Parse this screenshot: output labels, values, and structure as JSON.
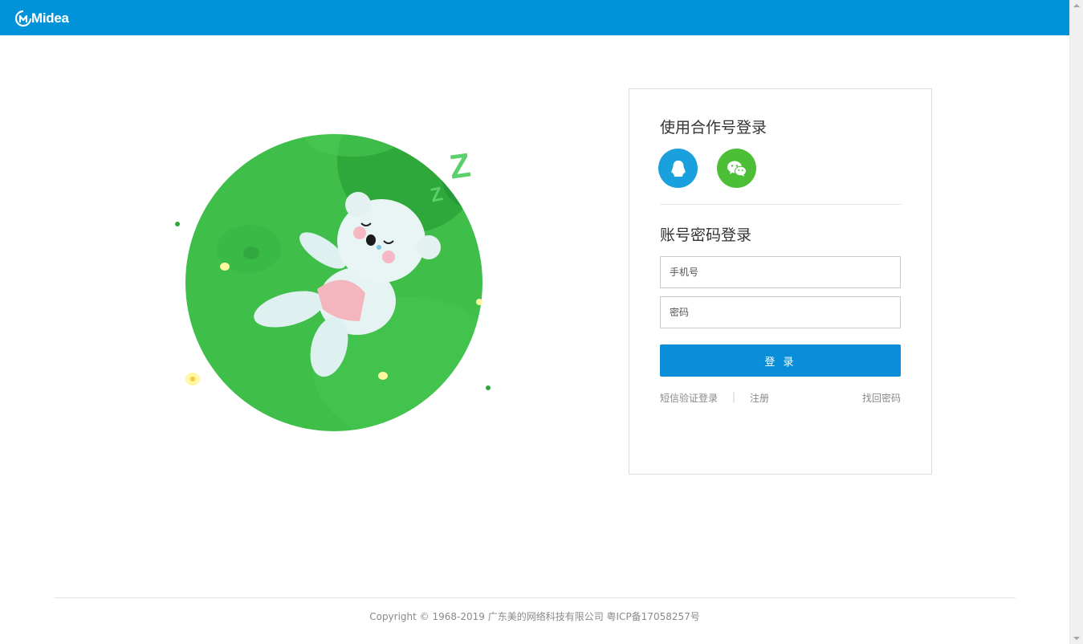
{
  "header": {
    "logo_text": "Midea",
    "bar_color": "#0093d9"
  },
  "illustration": {
    "icon": "sleeping-bear-illustration",
    "snore_text": "Z"
  },
  "login": {
    "coop_title": "使用合作号登录",
    "qq_icon": "qq-penguin-icon",
    "wechat_icon": "wechat-bubbles-icon",
    "account_title": "账号密码登录",
    "phone_placeholder": "手机号",
    "password_placeholder": "密码",
    "submit_label": "登 录",
    "sms_login_link": "短信验证登录",
    "separator": "|",
    "register_link": "注册",
    "forgot_link": "找回密码",
    "accent_color": "#0b8ed9",
    "qq_color": "#1aa0dc",
    "wechat_color": "#4cbf37"
  },
  "footer": {
    "copyright": "Copyright © 1968-2019 广东美的网络科技有限公司 粤ICP备17058257号"
  }
}
